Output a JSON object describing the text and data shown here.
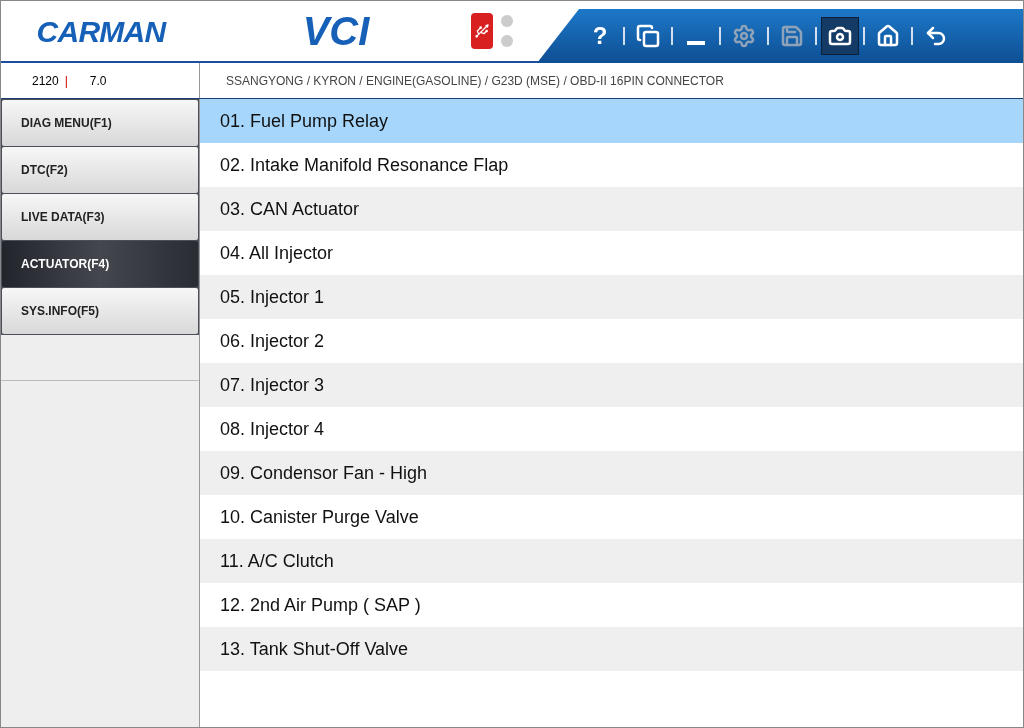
{
  "header": {
    "logo": "CARMAN",
    "product": "VCI",
    "toolbar": [
      {
        "kind": "help",
        "label": "?",
        "disabled": false,
        "selected": false
      },
      {
        "kind": "windows",
        "disabled": false,
        "selected": false
      },
      {
        "kind": "minimize",
        "disabled": false,
        "selected": false
      },
      {
        "kind": "settings",
        "disabled": true,
        "selected": false
      },
      {
        "kind": "save",
        "disabled": true,
        "selected": false
      },
      {
        "kind": "camera",
        "disabled": false,
        "selected": true
      },
      {
        "kind": "home",
        "disabled": false,
        "selected": false
      },
      {
        "kind": "back",
        "disabled": false,
        "selected": false
      }
    ]
  },
  "info_bar": {
    "code": "2120",
    "separator": "|",
    "version": "7.0",
    "breadcrumb": "SSANGYONG / KYRON / ENGINE(GASOLINE) / G23D (MSE) / OBD-II 16PIN CONNECTOR"
  },
  "sidebar": {
    "items": [
      {
        "label": "DIAG MENU(F1)",
        "selected": false
      },
      {
        "label": "DTC(F2)",
        "selected": false
      },
      {
        "label": "LIVE DATA(F3)",
        "selected": false
      },
      {
        "label": "ACTUATOR(F4)",
        "selected": true
      },
      {
        "label": "SYS.INFO(F5)",
        "selected": false
      }
    ]
  },
  "list": [
    {
      "label": "01. Fuel Pump Relay",
      "selected": true
    },
    {
      "label": "02. Intake Manifold Resonance Flap",
      "selected": false
    },
    {
      "label": "03. CAN Actuator",
      "selected": false
    },
    {
      "label": "04. All Injector",
      "selected": false
    },
    {
      "label": "05. Injector 1",
      "selected": false
    },
    {
      "label": "06. Injector 2",
      "selected": false
    },
    {
      "label": "07. Injector 3",
      "selected": false
    },
    {
      "label": "08. Injector 4",
      "selected": false
    },
    {
      "label": "09. Condensor Fan - High",
      "selected": false
    },
    {
      "label": "10. Canister Purge Valve",
      "selected": false
    },
    {
      "label": "11. A/C Clutch",
      "selected": false
    },
    {
      "label": "12. 2nd Air Pump ( SAP )",
      "selected": false
    },
    {
      "label": "13. Tank Shut-Off Valve",
      "selected": false
    }
  ]
}
